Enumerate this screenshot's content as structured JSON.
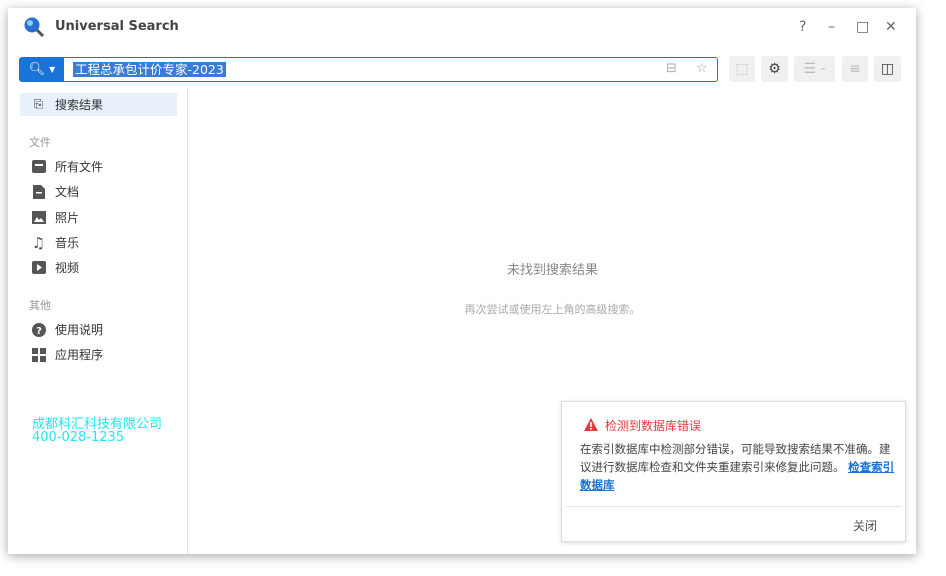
{
  "app": {
    "title": "Universal Search"
  },
  "window_controls": {
    "help": "?",
    "minimize": "–",
    "maximize": "□",
    "close": "✕"
  },
  "search": {
    "value": "工程总承包计价专家-2023"
  },
  "sidebar": {
    "results": "搜索结果",
    "files_section": "文件",
    "files": [
      {
        "label": "所有文件"
      },
      {
        "label": "文档"
      },
      {
        "label": "照片"
      },
      {
        "label": "音乐"
      },
      {
        "label": "视频"
      }
    ],
    "other_section": "其他",
    "other": [
      {
        "label": "使用说明"
      },
      {
        "label": "应用程序"
      }
    ],
    "company": "成都科汇科技有限公司",
    "phone": "400-028-1235"
  },
  "main": {
    "empty_title": "未找到搜索结果",
    "empty_hint": "再次尝试或使用左上角的高级搜索。"
  },
  "toast": {
    "title": "检测到数据库错误",
    "body": "在索引数据库中检测部分错误，可能导致搜索结果不准确。建议进行数据库检查和文件夹重建索引来修复此问题。",
    "link": "检查索引数据库",
    "close": "关闭"
  },
  "colors": {
    "accent": "#1a73d6",
    "error": "#e23b3b",
    "brand": "#22e6f0"
  }
}
